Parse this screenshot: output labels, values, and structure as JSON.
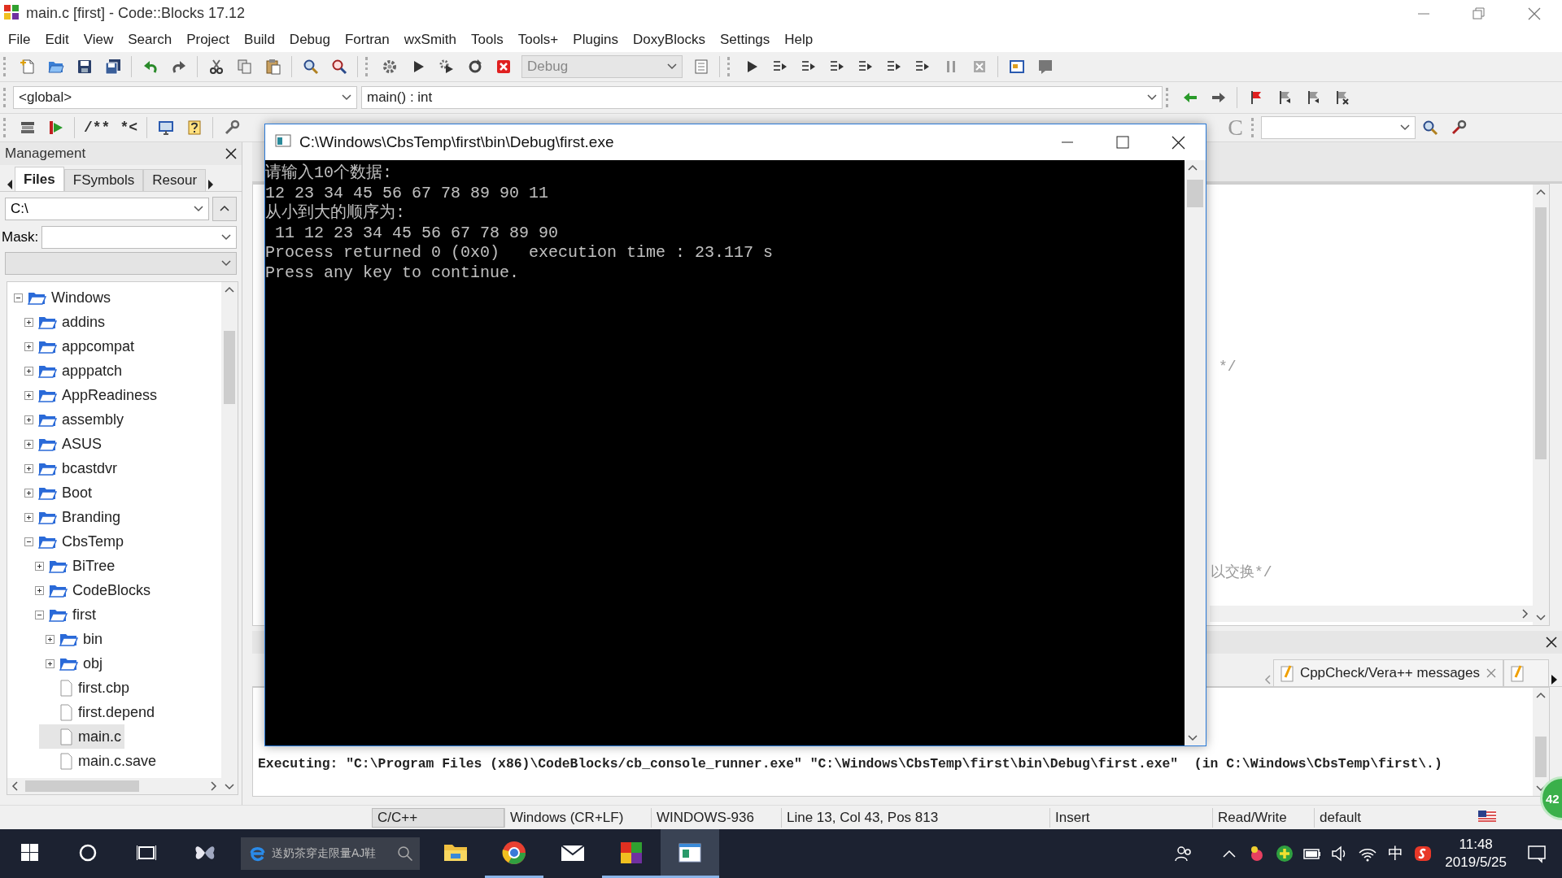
{
  "window": {
    "title": "main.c [first] - Code::Blocks 17.12"
  },
  "menu": [
    "File",
    "Edit",
    "View",
    "Search",
    "Project",
    "Build",
    "Debug",
    "Fortran",
    "wxSmith",
    "Tools",
    "Tools+",
    "Plugins",
    "DoxyBlocks",
    "Settings",
    "Help"
  ],
  "toolbar": {
    "build_target": "Debug",
    "scope": "<global>",
    "function": "main() : int",
    "doxy_buttons": [
      "/**",
      "*<"
    ],
    "c_button": "C"
  },
  "management": {
    "title": "Management",
    "tabs": [
      {
        "label": "Files",
        "selected": true
      },
      {
        "label": "FSymbols",
        "selected": false
      },
      {
        "label": "Resour",
        "selected": false
      }
    ],
    "path": "C:\\",
    "mask_label": "Mask:",
    "tree": [
      {
        "label": "Windows",
        "kind": "folder",
        "expanded": true,
        "selected": false,
        "children": [
          {
            "label": "addins",
            "kind": "folder",
            "expanded": false,
            "selected": false
          },
          {
            "label": "appcompat",
            "kind": "folder",
            "expanded": false,
            "selected": false
          },
          {
            "label": "apppatch",
            "kind": "folder",
            "expanded": false,
            "selected": false
          },
          {
            "label": "AppReadiness",
            "kind": "folder",
            "expanded": false,
            "selected": false
          },
          {
            "label": "assembly",
            "kind": "folder",
            "expanded": false,
            "selected": false
          },
          {
            "label": "ASUS",
            "kind": "folder",
            "expanded": false,
            "selected": false
          },
          {
            "label": "bcastdvr",
            "kind": "folder",
            "expanded": false,
            "selected": false
          },
          {
            "label": "Boot",
            "kind": "folder",
            "expanded": false,
            "selected": false
          },
          {
            "label": "Branding",
            "kind": "folder",
            "expanded": false,
            "selected": false
          },
          {
            "label": "CbsTemp",
            "kind": "folder",
            "expanded": true,
            "selected": false,
            "children": [
              {
                "label": "BiTree",
                "kind": "folder",
                "expanded": false,
                "selected": false
              },
              {
                "label": "CodeBlocks",
                "kind": "folder",
                "expanded": false,
                "selected": false
              },
              {
                "label": "first",
                "kind": "folder",
                "expanded": true,
                "selected": false,
                "children": [
                  {
                    "label": "bin",
                    "kind": "folder",
                    "expanded": false,
                    "selected": false
                  },
                  {
                    "label": "obj",
                    "kind": "folder",
                    "expanded": false,
                    "selected": false
                  },
                  {
                    "label": "first.cbp",
                    "kind": "file",
                    "selected": false
                  },
                  {
                    "label": "first.depend",
                    "kind": "file",
                    "selected": false
                  },
                  {
                    "label": "main.c",
                    "kind": "file",
                    "selected": true
                  },
                  {
                    "label": "main.c.save",
                    "kind": "file",
                    "selected": false
                  }
                ]
              }
            ]
          }
        ]
      }
    ]
  },
  "editor": {
    "fragments": [
      "*/",
      "以交换*/"
    ]
  },
  "log": {
    "tabs": [
      {
        "label": "CppCheck/Vera++ messages"
      }
    ],
    "lines": [
      "Executing: \"C:\\Program Files (x86)\\CodeBlocks/cb_console_runner.exe\" \"C:\\Windows\\CbsTemp\\first\\bin\\Debug\\first.exe\"  (in C:\\Windows\\CbsTemp\\first\\.)"
    ]
  },
  "status_bar": [
    "C/C++",
    "Windows (CR+LF)",
    "WINDOWS-936",
    "Line 13, Col 43, Pos 813",
    "Insert",
    "Read/Write",
    "default"
  ],
  "console": {
    "title": "C:\\Windows\\CbsTemp\\first\\bin\\Debug\\first.exe",
    "lines": [
      "请输入10个数据:",
      "12 23 34 45 56 67 78 89 90 11",
      "从小到大的顺序为:",
      " 11 12 23 34 45 56 67 78 89 90",
      "Process returned 0 (0x0)   execution time : 23.117 s",
      "Press any key to continue."
    ]
  },
  "taskbar": {
    "search_text": "送奶茶穿走限量AJ鞋",
    "apps": [
      {
        "kind": "explorer",
        "running": false,
        "selected": false
      },
      {
        "kind": "browser",
        "running": true,
        "selected": false
      },
      {
        "kind": "mail",
        "running": false,
        "selected": false
      },
      {
        "kind": "office",
        "running": true,
        "selected": false
      },
      {
        "kind": "codeblocks",
        "running": true,
        "selected": true
      }
    ],
    "ime": "中",
    "time": "11:48",
    "date": "2019/5/25"
  },
  "float_badge": "42"
}
